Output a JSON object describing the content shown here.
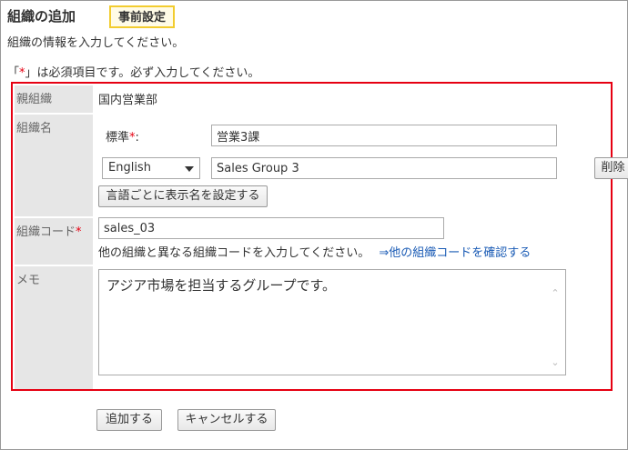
{
  "header": {
    "title": "組織の追加",
    "badge": "事前設定",
    "description": "組織の情報を入力してください。"
  },
  "required_note": {
    "open": "「",
    "mark": "*",
    "close": "」は必須項目です。必ず入力してください。"
  },
  "form": {
    "parent_org": {
      "label": "親組織",
      "value": "国内営業部"
    },
    "org_name": {
      "label": "組織名",
      "standard_label": "標準",
      "standard_suffix": ":",
      "required_mark": "*",
      "standard_value": "営業3課",
      "language_select": "English",
      "language_value": "Sales Group 3",
      "delete_button": "削除",
      "set_per_language_button": "言語ごとに表示名を設定する"
    },
    "org_code": {
      "label": "組織コード",
      "required_mark": "*",
      "value": "sales_03",
      "hint": "他の組織と異なる組織コードを入力してください。",
      "check_link": "⇒他の組織コードを確認する"
    },
    "memo": {
      "label": "メモ",
      "value": "アジア市場を担当するグループです。"
    }
  },
  "actions": {
    "add": "追加する",
    "cancel": "キャンセルする"
  },
  "colors": {
    "required": "#e60012",
    "badge_border": "#f2cc2e",
    "link": "#1a5bb5",
    "label_bg": "#e6e6e6"
  }
}
